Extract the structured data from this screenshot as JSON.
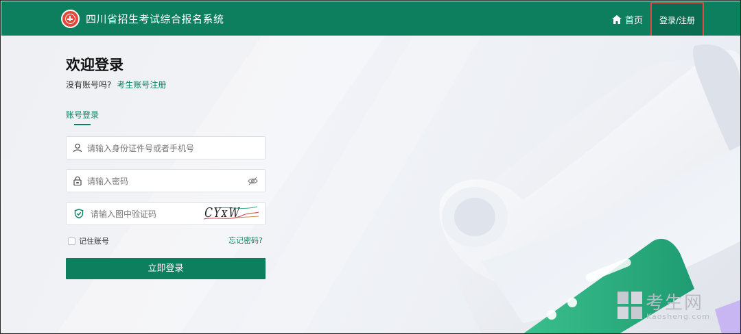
{
  "header": {
    "site_title": "四川省招生考试综合报名系统",
    "home_label": "首页",
    "login_register_label": "登录/注册"
  },
  "login": {
    "welcome_title": "欢迎登录",
    "no_account_text": "没有账号吗?",
    "register_link": "考生账号注册",
    "tab_account": "账号登录",
    "id_placeholder": "请输入身份证件号或者手机号",
    "password_placeholder": "请输入密码",
    "captcha_placeholder": "请输入图中验证码",
    "captcha_code": "CYxW",
    "remember_label": "记住账号",
    "forgot_label": "忘记密码?",
    "submit_label": "立即登录"
  },
  "watermark": {
    "text": "考生网",
    "sub": "Kaosheng.com"
  },
  "colors": {
    "brand_green": "#0d7f5f",
    "highlight_red": "#e04848",
    "logo_red": "#e5483a"
  },
  "icons": {
    "logo": "emblem-icon",
    "home": "home-icon",
    "user": "user-icon",
    "lock": "lock-icon",
    "eye": "eye-off-icon",
    "shield": "shield-check-icon"
  }
}
